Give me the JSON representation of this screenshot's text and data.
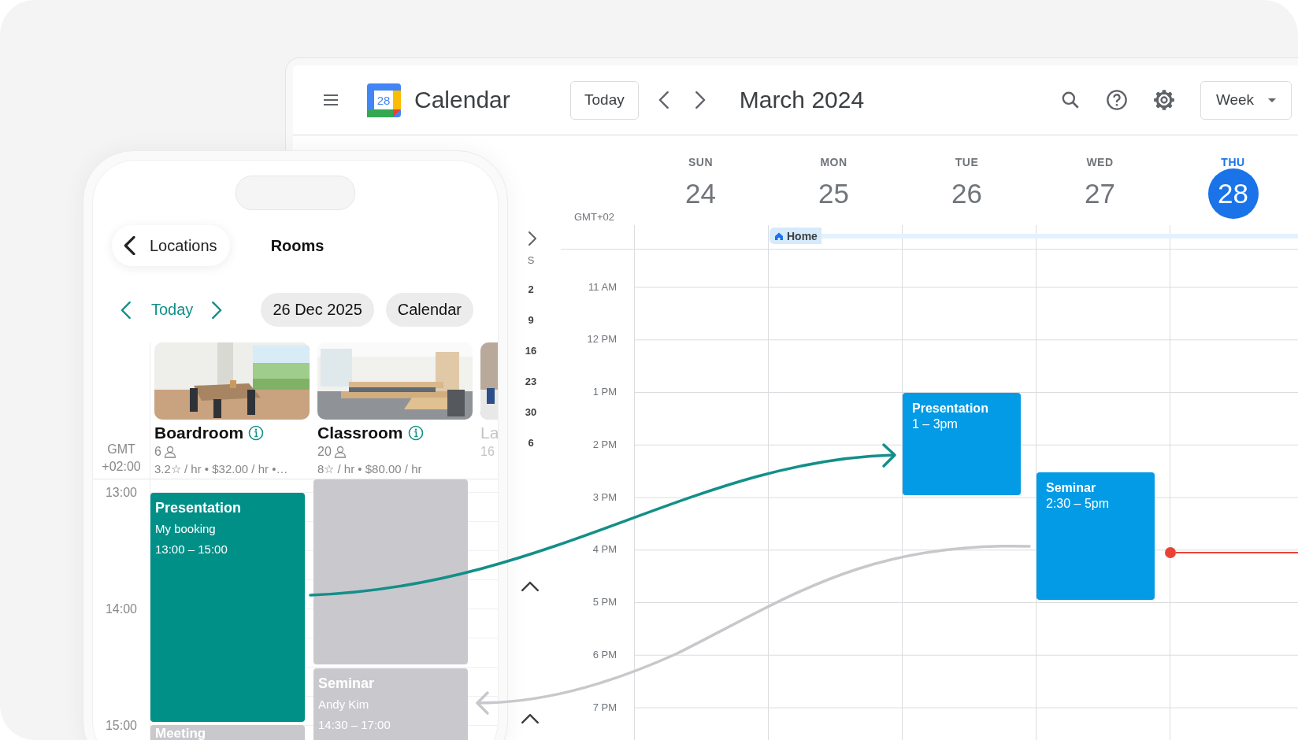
{
  "desktop": {
    "logo_date": "28",
    "app_name": "Calendar",
    "today_button": "Today",
    "period": "March 2024",
    "view_button": "Week",
    "timezone": "GMT+02",
    "days": [
      {
        "weekday": "SUN",
        "date": "24",
        "selected": false
      },
      {
        "weekday": "MON",
        "date": "25",
        "selected": false,
        "all_day_event": {
          "title": "Home"
        }
      },
      {
        "weekday": "TUE",
        "date": "26",
        "selected": false,
        "events": [
          {
            "title": "Presentation",
            "time": "1 – 3pm"
          }
        ]
      },
      {
        "weekday": "WED",
        "date": "27",
        "selected": false,
        "events": [
          {
            "title": "Seminar",
            "time": "2:30 – 5pm"
          }
        ]
      },
      {
        "weekday": "THU",
        "date": "28",
        "selected": true,
        "current_time": true
      }
    ],
    "hours": [
      "11 AM",
      "12 PM",
      "1 PM",
      "2 PM",
      "3 PM",
      "4 PM",
      "5 PM",
      "6 PM",
      "7 PM"
    ],
    "mini_calendar": {
      "weekday": "S",
      "dates": [
        "2",
        "9",
        "16",
        "23",
        "30",
        "6"
      ]
    }
  },
  "phone": {
    "back_button": "Locations",
    "title": "Rooms",
    "today": "Today",
    "date": "26 Dec 2025",
    "view_button": "Calendar",
    "timezone": "GMT +02:00",
    "hours": [
      "13:00",
      "14:00",
      "15:00"
    ],
    "rooms": [
      {
        "kind": "room",
        "name": "Boardroom",
        "capacity": "6",
        "price": "3.2☆ / hr • $32.00 / hr •…",
        "events": [
          {
            "kind": "mine",
            "title": "Presentation",
            "subtitle": "My booking",
            "time": "13:00 – 15:00"
          },
          {
            "kind": "other",
            "title": "Meeting"
          }
        ]
      },
      {
        "kind": "room",
        "name": "Classroom",
        "capacity": "20",
        "price": "8☆ / hr • $80.00 / hr",
        "events": [
          {
            "kind": "blocked"
          },
          {
            "kind": "other",
            "title": "Seminar",
            "subtitle": "Andy Kim",
            "time": "14:30 – 17:00"
          }
        ]
      },
      {
        "kind": "partial",
        "name": "La",
        "capacity": "16"
      }
    ]
  }
}
